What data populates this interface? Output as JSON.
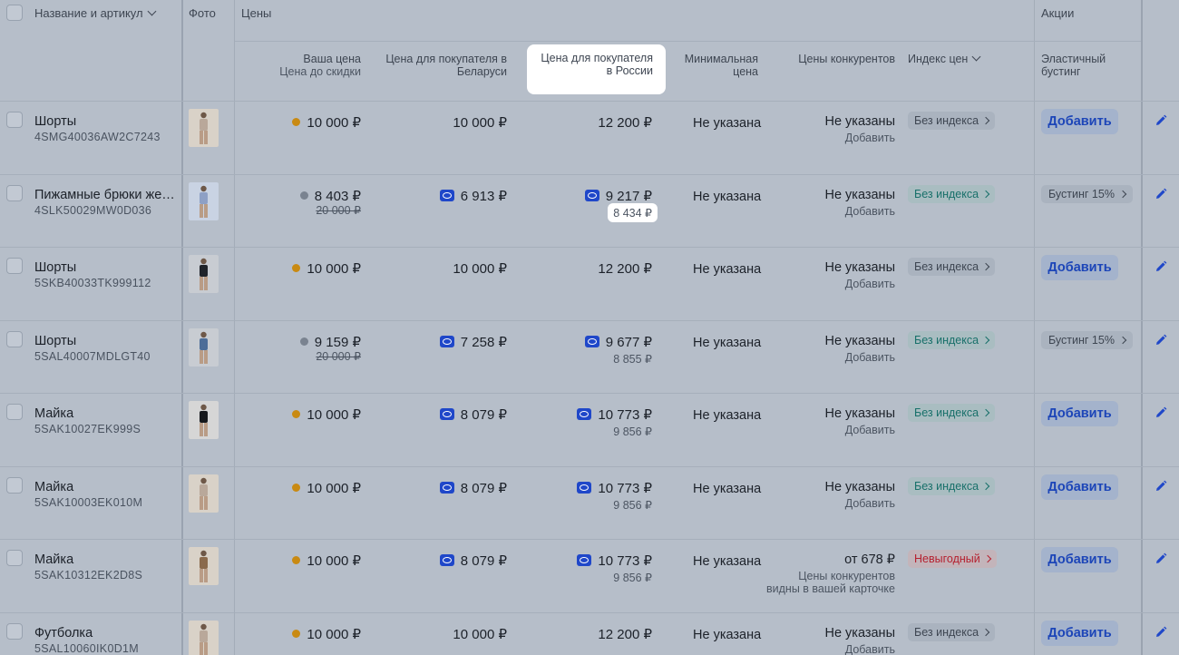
{
  "header": {
    "name_col": "Название и артикул",
    "photo_col": "Фото",
    "prices_group": "Цены",
    "promos_group": "Акции",
    "your_price": "Ваша цена",
    "price_before_discount": "Цена до скидки",
    "buyer_price_belarus": "Цена для покупателя в Беларуси",
    "buyer_price_russia": "Цена для покупателя в России",
    "min_price": "Минимальная цена",
    "competitor_prices": "Цены конкурентов",
    "price_index": "Индекс цен",
    "elastic_boost": "Эластичный бустинг"
  },
  "colors": {
    "add_button_text": "#1c45b8",
    "wb_badge": "#1f47c9",
    "warning_dot": "#c98a12",
    "good_index": "#18706a",
    "bad_index": "#b5202f"
  },
  "rows": [
    {
      "name": "Шорты",
      "sku": "4SMG40036AW2C7243",
      "your_price": "10 000 ₽",
      "your_icon": "warn",
      "old_price": "",
      "by_price": "10 000 ₽",
      "by_wb": false,
      "ru_price": "12 200 ₽",
      "ru_wb": false,
      "ru_sub": "",
      "min_price": "Не указана",
      "competitor": "Не указаны",
      "competitor_link": "Добавить",
      "index": "Без индекса",
      "index_style": "grey",
      "promo_type": "add",
      "promo": "Добавить",
      "photo": "light"
    },
    {
      "name": "Пижамные брюки жен…",
      "sku": "4SLK50029MW0D036",
      "your_price": "8 403 ₽",
      "your_icon": "gear",
      "old_price": "20 000 ₽",
      "by_price": "6 913 ₽",
      "by_wb": true,
      "ru_price": "9 217 ₽",
      "ru_wb": true,
      "ru_sub": "8 434 ₽",
      "ru_sub_highlight": true,
      "min_price": "Не указана",
      "competitor": "Не указаны",
      "competitor_link": "Добавить",
      "index": "Без индекса",
      "index_style": "green",
      "promo_type": "boost",
      "promo": "Бустинг 15%",
      "photo": "blue"
    },
    {
      "name": "Шорты",
      "sku": "5SKB40033TK999112",
      "your_price": "10 000 ₽",
      "your_icon": "warn",
      "old_price": "",
      "by_price": "10 000 ₽",
      "by_wb": false,
      "ru_price": "12 200 ₽",
      "ru_wb": false,
      "ru_sub": "",
      "min_price": "Не указана",
      "competitor": "Не указаны",
      "competitor_link": "Добавить",
      "index": "Без индекса",
      "index_style": "grey",
      "promo_type": "add",
      "promo": "Добавить",
      "photo": "dark"
    },
    {
      "name": "Шорты",
      "sku": "5SAL40007MDLGT40",
      "your_price": "9 159 ₽",
      "your_icon": "gear",
      "old_price": "20 000 ₽",
      "by_price": "7 258 ₽",
      "by_wb": true,
      "ru_price": "9 677 ₽",
      "ru_wb": true,
      "ru_sub": "8 855 ₽",
      "min_price": "Не указана",
      "competitor": "Не указаны",
      "competitor_link": "Добавить",
      "index": "Без индекса",
      "index_style": "green",
      "promo_type": "boost",
      "promo": "Бустинг 15%",
      "photo": "denim"
    },
    {
      "name": "Майка",
      "sku": "5SAK10027EK999S",
      "your_price": "10 000 ₽",
      "your_icon": "warn",
      "old_price": "",
      "by_price": "8 079 ₽",
      "by_wb": true,
      "ru_price": "10 773 ₽",
      "ru_wb": true,
      "ru_sub": "9 856 ₽",
      "min_price": "Не указана",
      "competitor": "Не указаны",
      "competitor_link": "Добавить",
      "index": "Без индекса",
      "index_style": "green",
      "promo_type": "add",
      "promo": "Добавить",
      "photo": "black"
    },
    {
      "name": "Майка",
      "sku": "5SAK10003EK010M",
      "your_price": "10 000 ₽",
      "your_icon": "warn",
      "old_price": "",
      "by_price": "8 079 ₽",
      "by_wb": true,
      "ru_price": "10 773 ₽",
      "ru_wb": true,
      "ru_sub": "9 856 ₽",
      "min_price": "Не указана",
      "competitor": "Не указаны",
      "competitor_link": "Добавить",
      "index": "Без индекса",
      "index_style": "green",
      "promo_type": "add",
      "promo": "Добавить",
      "photo": "light"
    },
    {
      "name": "Майка",
      "sku": "5SAK10312EK2D8S",
      "your_price": "10 000 ₽",
      "your_icon": "warn",
      "old_price": "",
      "by_price": "8 079 ₽",
      "by_wb": true,
      "ru_price": "10 773 ₽",
      "ru_wb": true,
      "ru_sub": "9 856 ₽",
      "min_price": "Не указана",
      "competitor": "от 678 ₽",
      "competitor_link": "Цены конкурентов видны в вашей карточке",
      "index": "Невыгодный",
      "index_style": "red",
      "promo_type": "add",
      "promo": "Добавить",
      "photo": "tan"
    },
    {
      "name": "Футболка",
      "sku": "5SAL10060IK0D1M",
      "your_price": "10 000 ₽",
      "your_icon": "warn",
      "old_price": "",
      "by_price": "10 000 ₽",
      "by_wb": false,
      "ru_price": "12 200 ₽",
      "ru_wb": false,
      "ru_sub": "",
      "min_price": "Не указана",
      "competitor": "Не указаны",
      "competitor_link": "Добавить",
      "index": "Без индекса",
      "index_style": "grey",
      "promo_type": "add",
      "promo": "Добавить",
      "photo": "light"
    }
  ]
}
